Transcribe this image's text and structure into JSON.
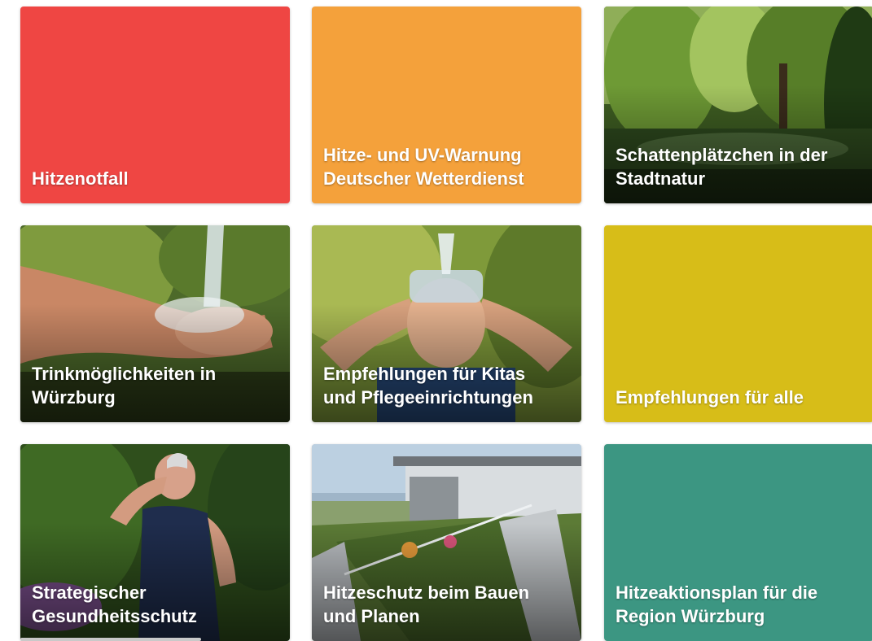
{
  "tiles": [
    {
      "label": "Hitzenotfall",
      "color": "#ef4643"
    },
    {
      "label": "Hitze- und UV-Warnung\nDeutscher Wetterdienst",
      "color": "#f4a13b"
    },
    {
      "label": "Schattenplätzchen in der\nStadtnatur"
    },
    {
      "label": "Trinkmöglichkeiten in\nWürzburg"
    },
    {
      "label": "Empfehlungen für Kitas\nund Pflegeeinrichtungen"
    },
    {
      "label": "Empfehlungen für alle",
      "color": "#d7bd18"
    },
    {
      "label": "Strategischer\nGesundheitsschutz"
    },
    {
      "label": "Hitzeschutz beim Bauen\nund Planen"
    },
    {
      "label": "Hitzeaktionsplan für die\nRegion Würzburg",
      "color": "#3c9682"
    }
  ]
}
